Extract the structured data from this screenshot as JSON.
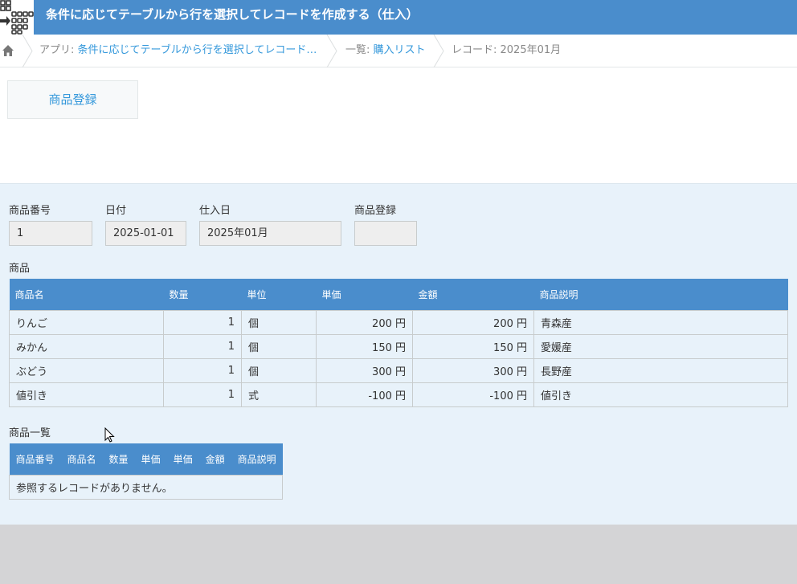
{
  "header": {
    "title": "条件に応じてテーブルから行を選択してレコードを作成する（仕入）"
  },
  "breadcrumb": {
    "app_prefix": "アプリ: ",
    "app_name": "条件に応じてテーブルから行を選択してレコード…",
    "list_prefix": "一覧: ",
    "list_name": "購入リスト",
    "record": "レコード: 2025年01月"
  },
  "toolbar": {
    "register_label": "商品登録"
  },
  "fields": {
    "product_no": {
      "label": "商品番号",
      "value": "1"
    },
    "date": {
      "label": "日付",
      "value": "2025-01-01"
    },
    "purchase_day": {
      "label": "仕入日",
      "value": "2025年01月"
    },
    "product_register": {
      "label": "商品登録",
      "value": ""
    }
  },
  "products_table": {
    "label": "商品",
    "headers": [
      "商品名",
      "数量",
      "単位",
      "単価",
      "金額",
      "商品説明"
    ],
    "rows": [
      [
        "りんご",
        "1",
        "個",
        "200 円",
        "200 円",
        "青森産"
      ],
      [
        "みかん",
        "1",
        "個",
        "150 円",
        "150 円",
        "愛媛産"
      ],
      [
        "ぶどう",
        "1",
        "個",
        "300 円",
        "300 円",
        "長野産"
      ],
      [
        "値引き",
        "1",
        "式",
        "-100 円",
        "-100 円",
        "値引き"
      ]
    ]
  },
  "product_list": {
    "label": "商品一覧",
    "headers": [
      "商品番号",
      "商品名",
      "数量",
      "単価",
      "単価",
      "金額",
      "商品説明"
    ],
    "empty_message": "参照するレコードがありません。"
  },
  "colors": {
    "accent": "#4a8dcc",
    "link": "#3498db",
    "record_bg": "#e8f2fa",
    "footer_bg": "#d4d4d6"
  },
  "icons": [
    "app-icon",
    "home-icon",
    "chevron-right-icon",
    "mouse-cursor-icon"
  ]
}
